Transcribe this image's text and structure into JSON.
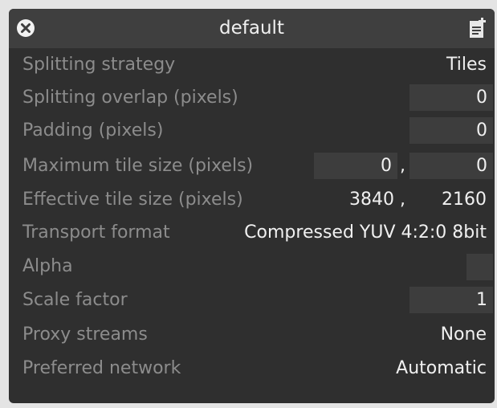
{
  "header": {
    "title": "default"
  },
  "rows": {
    "splitting_strategy": {
      "label": "Splitting strategy",
      "value": "Tiles"
    },
    "splitting_overlap": {
      "label": "Splitting overlap (pixels)",
      "value": "0"
    },
    "padding": {
      "label": "Padding (pixels)",
      "value": "0"
    },
    "max_tile_size": {
      "label": "Maximum tile size (pixels)",
      "width": "0",
      "separator": ",",
      "height": "0"
    },
    "effective_tile_size": {
      "label": "Effective tile size (pixels)",
      "width": "3840",
      "separator": ",",
      "height": "2160"
    },
    "transport_format": {
      "label": "Transport format",
      "value": "Compressed YUV 4:2:0 8bit"
    },
    "alpha": {
      "label": "Alpha",
      "checked": false
    },
    "scale_factor": {
      "label": "Scale factor",
      "value": "1"
    },
    "proxy_streams": {
      "label": "Proxy streams",
      "value": "None"
    },
    "preferred_network": {
      "label": "Preferred network",
      "value": "Automatic"
    }
  },
  "icons": {
    "close": "close-circle-icon",
    "document": "document-add-icon"
  },
  "colors": {
    "panel_bg": "#2f2f2f",
    "header_bg": "#3f3f3f",
    "field_bg": "#3d3d3d",
    "label_text": "#8c8c8c",
    "value_text": "#f0f0f0"
  }
}
